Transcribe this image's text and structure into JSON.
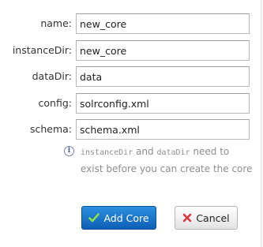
{
  "form": {
    "fields": [
      {
        "label": "name:",
        "value": "new_core"
      },
      {
        "label": "instanceDir:",
        "value": "new_core"
      },
      {
        "label": "dataDir:",
        "value": "data"
      },
      {
        "label": "config:",
        "value": "solrconfig.xml"
      },
      {
        "label": "schema:",
        "value": "schema.xml"
      }
    ]
  },
  "note": {
    "icon": "info-icon",
    "code1": "instanceDir",
    "and": " and ",
    "code2": "dataDir",
    "rest": " need to exist before you can create the core"
  },
  "buttons": {
    "add_label": "Add Core",
    "add_icon": "check-icon",
    "cancel_label": "Cancel",
    "cancel_icon": "x-icon"
  },
  "colors": {
    "primary": "#1a73c9",
    "check": "#7fd43a",
    "cancel_x": "#d63a3a",
    "note_text": "#8e8e8e"
  }
}
